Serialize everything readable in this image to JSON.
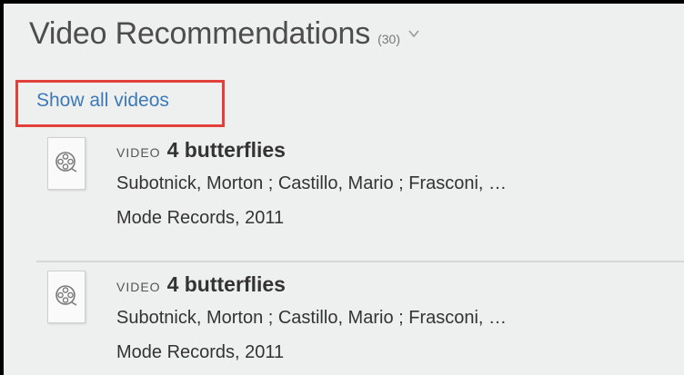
{
  "header": {
    "title": "Video Recommendations",
    "count": "(30)",
    "chevron_icon": "chevron-down-icon"
  },
  "show_all": {
    "label": "Show all videos"
  },
  "results": [
    {
      "type": "VIDEO",
      "title": "4 butterflies",
      "authors": "Subotnick, Morton ; Castillo, Mario ; Frasconi, …",
      "publisher": "Mode Records, 2011",
      "icon": "film-reel-icon"
    },
    {
      "type": "VIDEO",
      "title": "4 butterflies",
      "authors": "Subotnick, Morton ; Castillo, Mario ; Frasconi, …",
      "publisher": "Mode Records, 2011",
      "icon": "film-reel-icon"
    }
  ],
  "colors": {
    "link": "#3d79b8",
    "highlight_border": "#e2413b",
    "background": "#edf0ef",
    "frame": "#000000"
  }
}
